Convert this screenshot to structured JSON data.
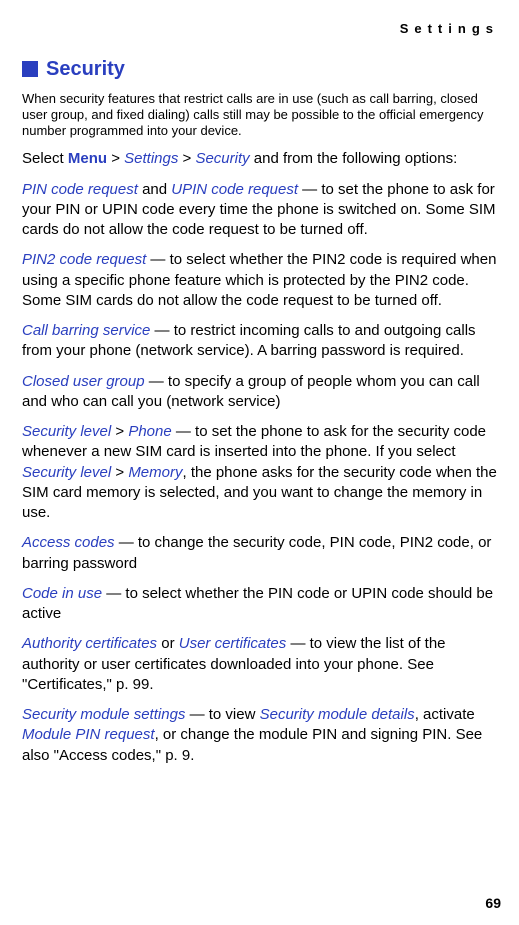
{
  "header": {
    "label": "Settings"
  },
  "section": {
    "title": "Security"
  },
  "intro": "When security features that restrict calls are in use (such as call barring, closed user group, and fixed dialing) calls still may be possible to the official emergency number programmed into your device.",
  "select_line": {
    "prefix": "Select ",
    "menu": "Menu",
    "gt1": " > ",
    "settings": "Settings",
    "gt2": " > ",
    "security": "Security",
    "suffix": " and from the following options:"
  },
  "items": {
    "pin": {
      "t1": "PIN code request",
      "and": " and ",
      "t2": "UPIN code request",
      "desc": " — to set the phone to ask for your PIN or UPIN code every time the phone is switched on. Some SIM cards do not allow the code request to be turned off."
    },
    "pin2": {
      "t": "PIN2 code request",
      "desc": " — to select whether the PIN2 code is required when using a specific phone feature which is protected by the PIN2 code. Some SIM cards do not allow the code request to be turned off."
    },
    "barring": {
      "t": "Call barring service",
      "desc": " — to restrict incoming calls to and outgoing calls from your phone (network service). A barring password is required."
    },
    "cug": {
      "t": "Closed user group",
      "desc": " — to specify a group of people whom you can call and who can call you (network service)"
    },
    "seclevel": {
      "t1": "Security level",
      "gt1": " > ",
      "phone": "Phone",
      "desc1": " — to set the phone to ask for the security code whenever a new SIM card is inserted into the phone. If you select ",
      "t2": "Security level",
      "gt2": " > ",
      "memory": "Memory",
      "desc2": ", the phone asks for the security code when the SIM card memory is selected, and you want to change the memory in use."
    },
    "access": {
      "t": "Access codes",
      "desc": " — to change the security code, PIN code, PIN2 code, or barring password"
    },
    "codeinuse": {
      "t": "Code in use",
      "desc": " — to select whether the PIN code or UPIN code should be active"
    },
    "certs": {
      "t1": "Authority certificates",
      "or": " or ",
      "t2": "User certificates",
      "desc": " — to view the list of the authority or user certificates downloaded into your phone. See \"Certificates,\" p. 99."
    },
    "secmod": {
      "t": "Security module settings",
      "d1": " — to view ",
      "d2": "Security module details",
      "d3": ", activate ",
      "d4": "Module PIN request",
      "d5": ", or change the module PIN and signing PIN. See also \"Access codes,\" p. 9."
    }
  },
  "page_number": "69"
}
